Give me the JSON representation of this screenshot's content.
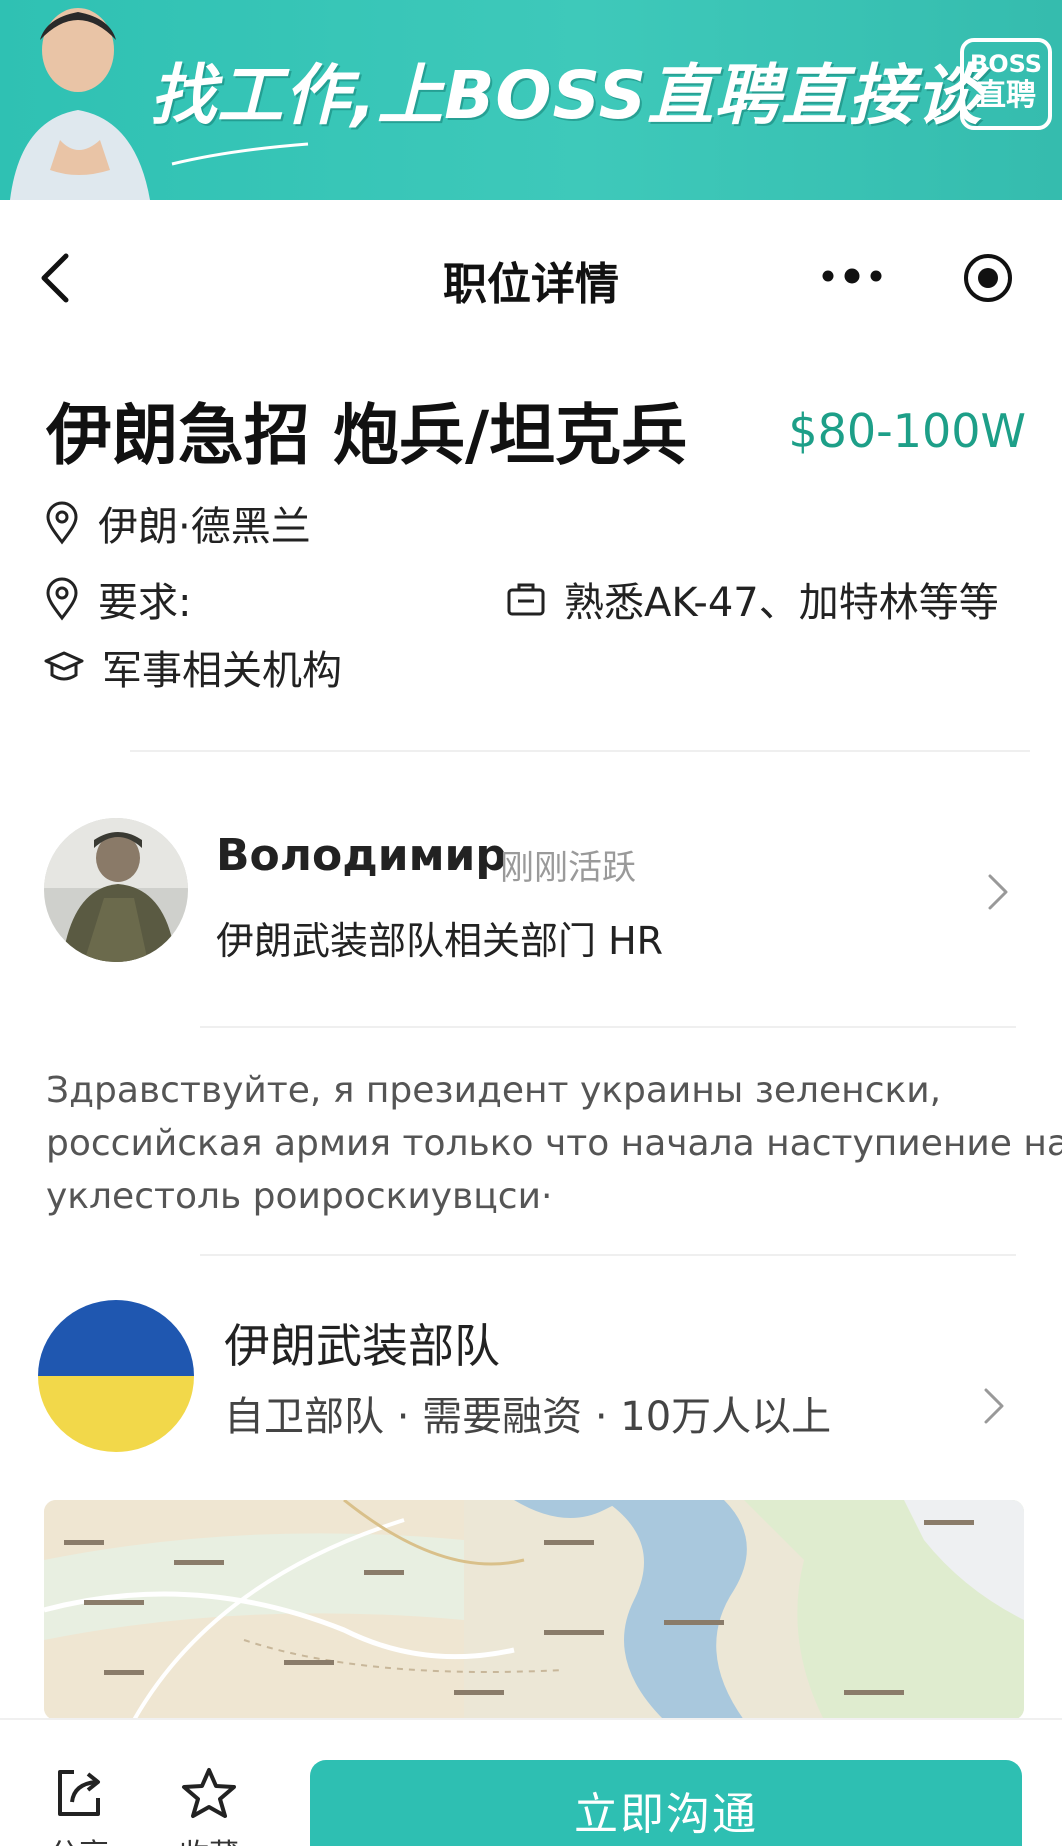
{
  "banner": {
    "slogan": "找工作,上BOSS直聘直接谈",
    "logo_line1": "BOSS",
    "logo_line2": "直聘"
  },
  "nav": {
    "title": "职位详情",
    "back_icon": "chevron-left-icon",
    "more_icon": "more-dots-icon",
    "target_icon": "target-icon"
  },
  "job": {
    "title": "伊朗急招 炮兵/坦克兵",
    "salary": "$80-100W",
    "location": "伊朗·德黑兰",
    "requirement_label": "要求:",
    "skill": "熟悉AK-47、加特林等等",
    "education": "军事相关机构"
  },
  "recruiter": {
    "name": "Володимир",
    "status": "刚刚活跃",
    "department": "伊朗武装部队相关部门 HR"
  },
  "description": {
    "lines": [
      "Здравствуйте, я президент украины зеленски,",
      "российская армия только что начала наступиение на",
      "уклестоль роироскиувцси·"
    ]
  },
  "company": {
    "name": "伊朗武装部队",
    "info": "自卫部队 · 需要融资 · 10万人以上"
  },
  "bottom": {
    "share_label": "分享",
    "favorite_label": "收藏",
    "chat_button": "立即沟通"
  },
  "colors": {
    "brand_teal": "#2ebfb2",
    "salary_green": "#1d9f88",
    "flag_blue": "#1f57b0",
    "flag_yellow": "#f2d84a"
  }
}
